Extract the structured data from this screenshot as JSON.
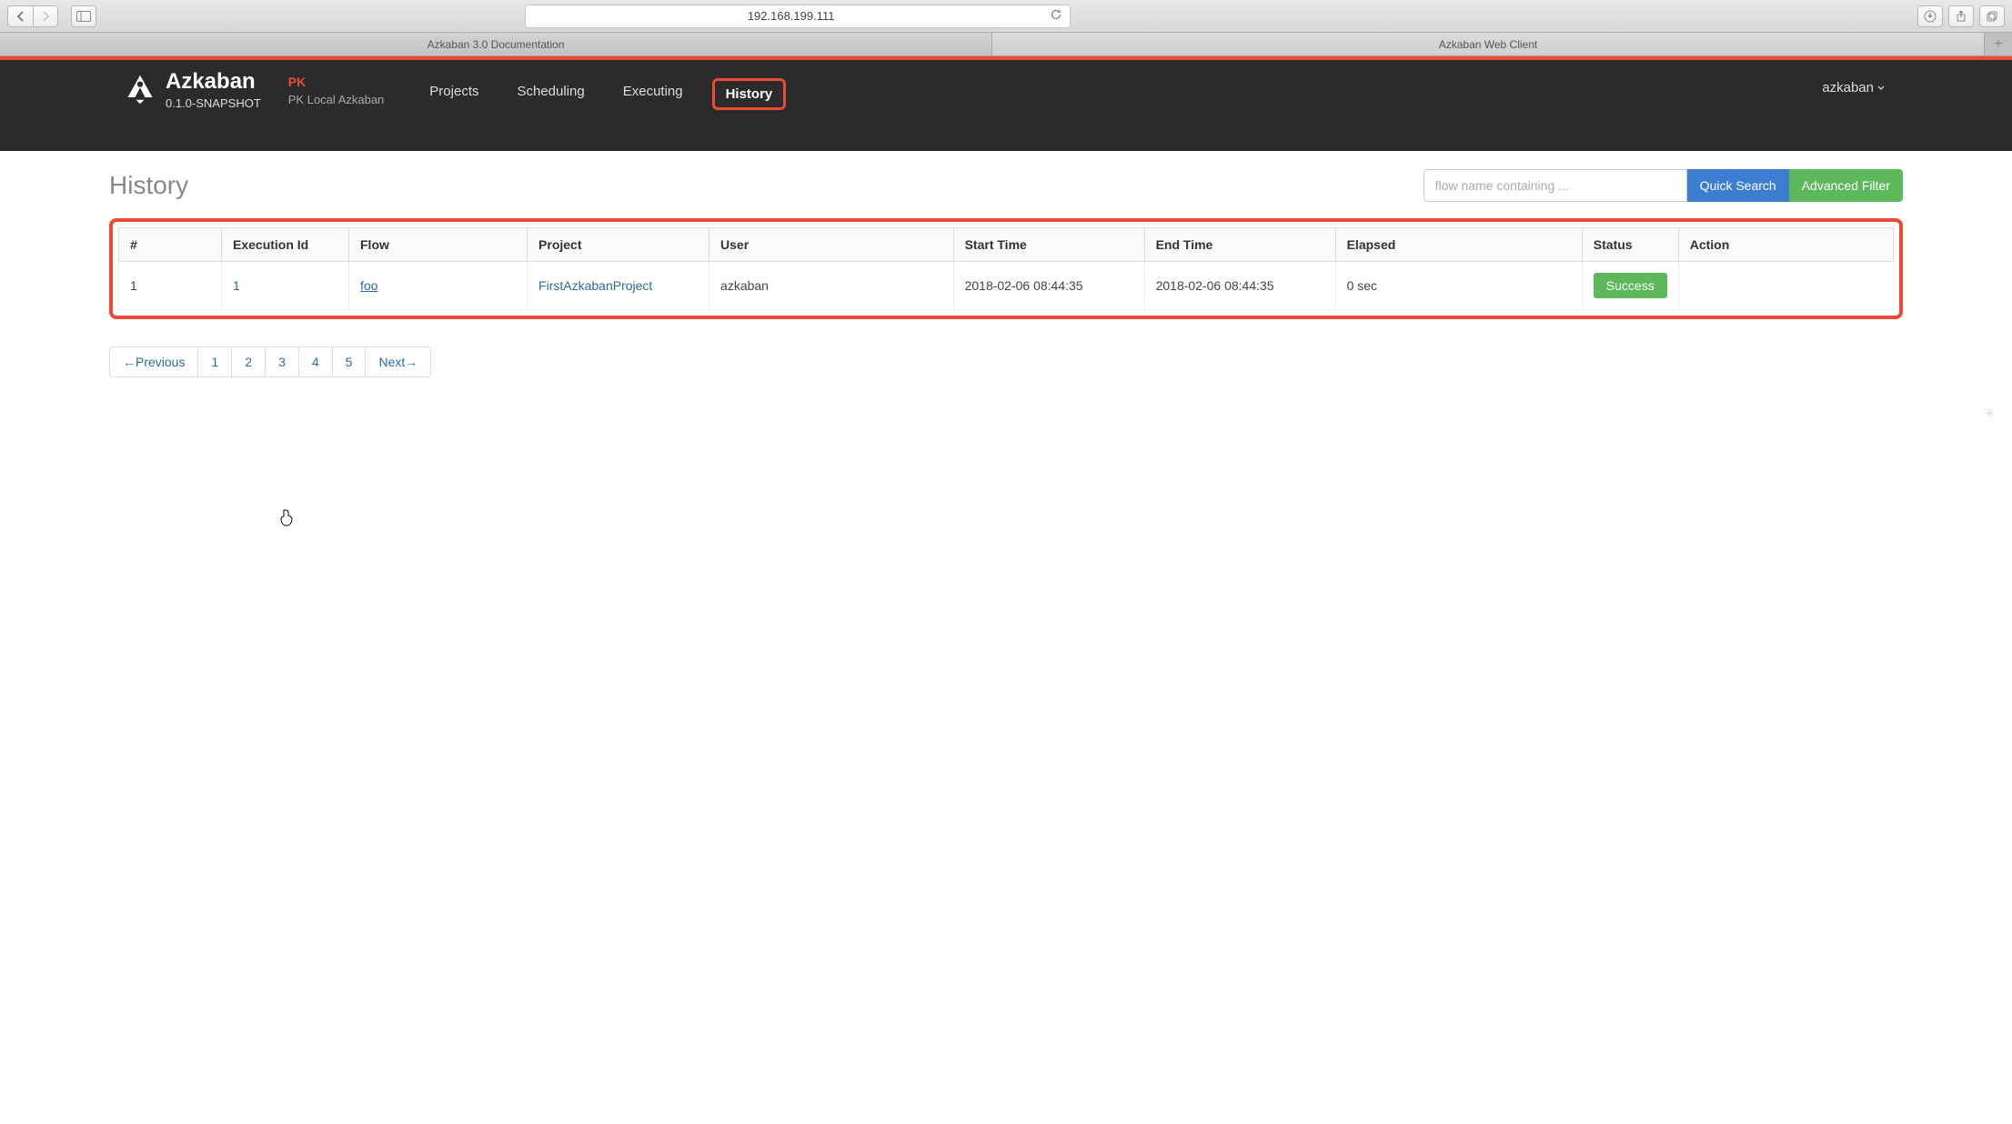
{
  "browser": {
    "url": "192.168.199.111",
    "tabs": [
      "Azkaban 3.0 Documentation",
      "Azkaban Web Client"
    ]
  },
  "header": {
    "appName": "Azkaban",
    "version": "0.1.0-SNAPSHOT",
    "orgShort": "PK",
    "orgFull": "PK Local Azkaban",
    "nav": {
      "projects": "Projects",
      "scheduling": "Scheduling",
      "executing": "Executing",
      "history": "History"
    },
    "user": "azkaban"
  },
  "page": {
    "title": "History",
    "search": {
      "placeholder": "flow name containing ...",
      "quickSearchLabel": "Quick Search",
      "advancedFilterLabel": "Advanced Filter"
    }
  },
  "table": {
    "columns": {
      "num": "#",
      "executionId": "Execution Id",
      "flow": "Flow",
      "project": "Project",
      "user": "User",
      "startTime": "Start Time",
      "endTime": "End Time",
      "elapsed": "Elapsed",
      "status": "Status",
      "action": "Action"
    },
    "rows": [
      {
        "num": "1",
        "executionId": "1",
        "flow": "foo",
        "project": "FirstAzkabanProject",
        "user": "azkaban",
        "startTime": "2018-02-06 08:44:35",
        "endTime": "2018-02-06 08:44:35",
        "elapsed": "0 sec",
        "status": "Success",
        "action": ""
      }
    ]
  },
  "pagination": {
    "prev": "←Previous",
    "pages": [
      "1",
      "2",
      "3",
      "4",
      "5"
    ],
    "next": "Next→"
  }
}
